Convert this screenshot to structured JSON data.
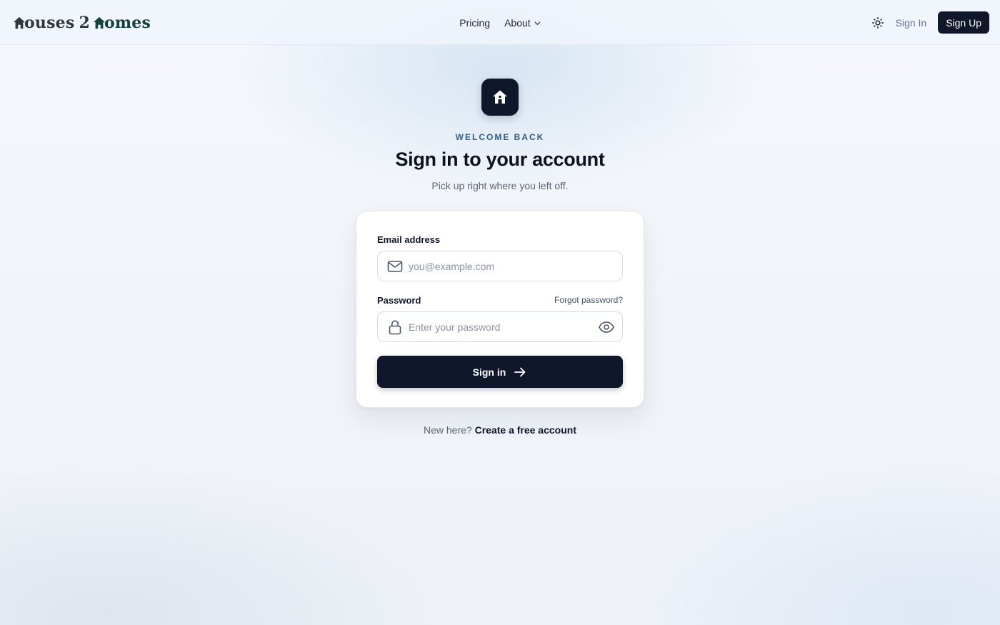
{
  "header": {
    "logo": {
      "part1": "ouses",
      "num": "2",
      "part2": "omes"
    },
    "nav": [
      {
        "label": "Pricing"
      },
      {
        "label": "About"
      }
    ],
    "sign_in_label": "Sign In",
    "sign_up_label": "Sign Up"
  },
  "hero": {
    "eyebrow": "WELCOME BACK",
    "title": "Sign in to your account",
    "subtitle": "Pick up right where you left off."
  },
  "form": {
    "email_label": "Email address",
    "email_placeholder": "you@example.com",
    "email_value": "",
    "password_label": "Password",
    "forgot_label": "Forgot password?",
    "password_placeholder": "Enter your password",
    "password_value": "",
    "submit_label": "Sign in"
  },
  "footer": {
    "prompt": "New here?",
    "cta": "Create a free account"
  },
  "icons": {
    "logo": "house-roof-icon",
    "about_caret": "chevron-down-icon",
    "theme": "sun-icon",
    "brand": "home-icon",
    "email": "mail-icon",
    "password": "lock-icon",
    "reveal": "eye-icon",
    "submit": "arrow-right-icon"
  },
  "colors": {
    "primary": "#0f172a",
    "eyebrow": "#2b5f8a",
    "logo_dark": "#2f3b3b",
    "logo_green": "#12433d"
  }
}
